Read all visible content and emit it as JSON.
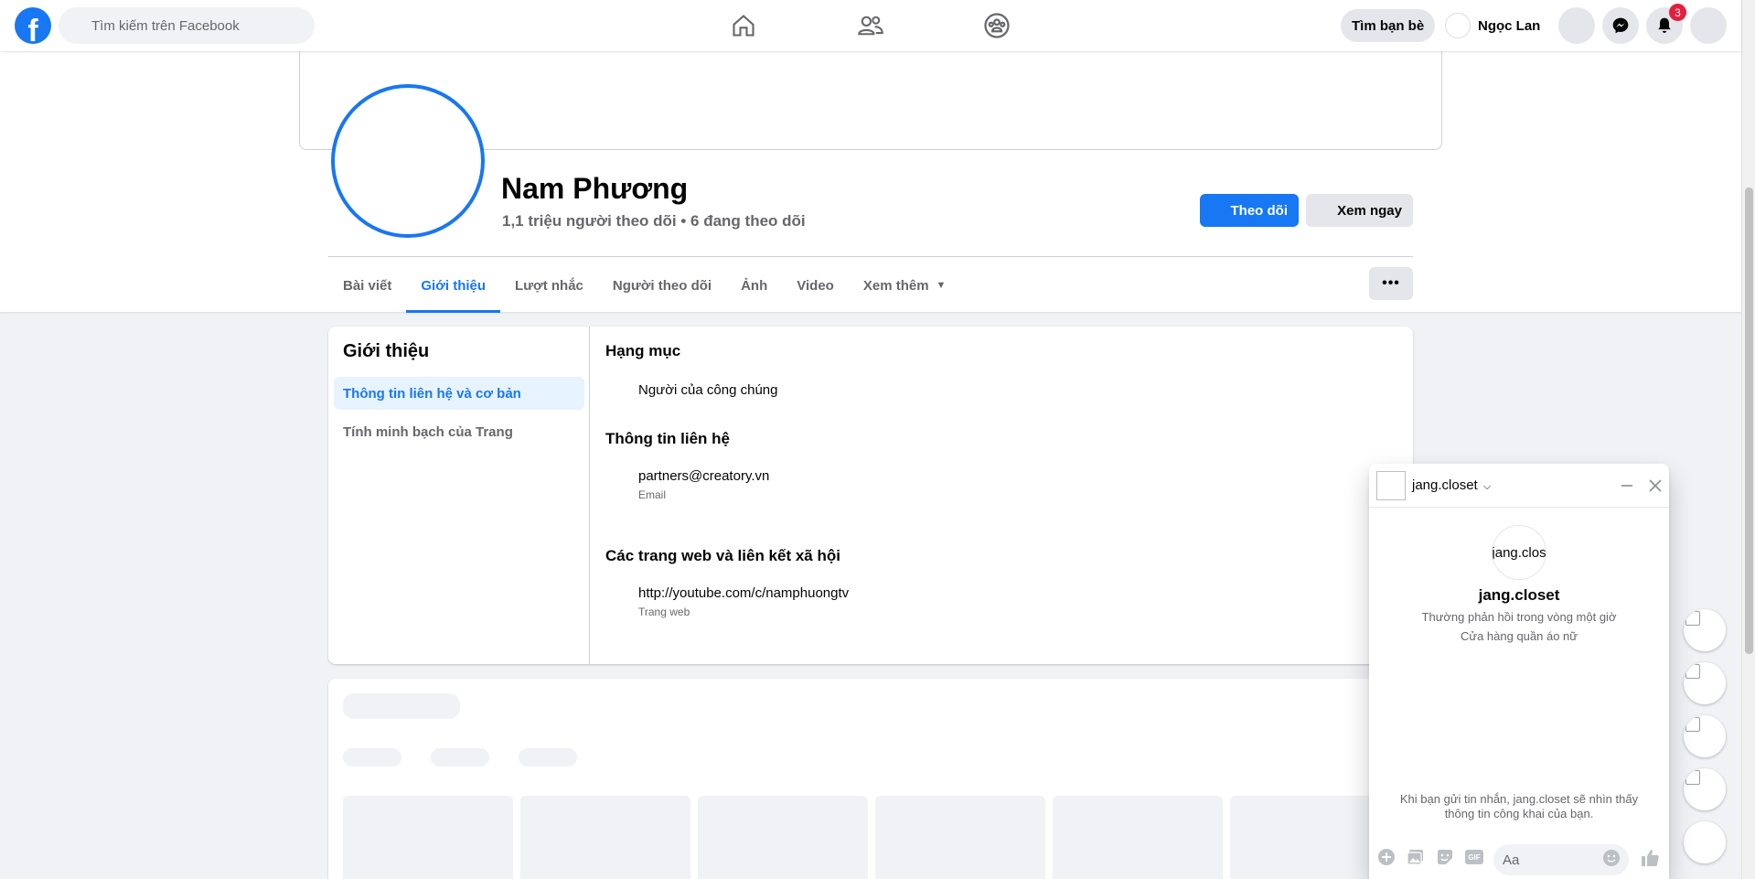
{
  "topbar": {
    "search_placeholder": "Tìm kiếm trên Facebook",
    "find_friends": "Tìm bạn bè",
    "user_name": "Ngọc Lan",
    "notification_count": "3",
    "logo_letter": "f"
  },
  "profile": {
    "name": "Nam Phương",
    "followers": "1,1 triệu người theo dõi • 6 đang theo dõi",
    "follow_label": "Theo dõi",
    "view_label": "Xem ngay",
    "more_label": "•••"
  },
  "tabs": [
    {
      "label": "Bài viết"
    },
    {
      "label": "Giới thiệu"
    },
    {
      "label": "Lượt nhắc"
    },
    {
      "label": "Người theo dõi"
    },
    {
      "label": "Ảnh"
    },
    {
      "label": "Video"
    },
    {
      "label": "Xem thêm"
    }
  ],
  "about": {
    "title": "Giới thiệu",
    "nav": [
      {
        "label": "Thông tin liên hệ và cơ bản"
      },
      {
        "label": "Tính minh bạch của Trang"
      }
    ],
    "category_title": "Hạng mục",
    "category_value": "Người của công chúng",
    "contact_title": "Thông tin liên hệ",
    "email_value": "partners@creatory.vn",
    "email_label": "Email",
    "web_title": "Các trang web và liên kết xã hội",
    "web_value": "http://youtube.com/c/namphuongtv",
    "web_label": "Trang web"
  },
  "chat": {
    "name": "jang.closet",
    "avatar_alt": "jang.clos",
    "title": "jang.closet",
    "reply_time": "Thường phản hồi trong vòng một giờ",
    "description": "Cửa hàng quần áo nữ",
    "note": "Khi bạn gửi tin nhắn, jang.closet sẽ nhìn thấy thông tin công khai của bạn.",
    "input_placeholder": "Aa",
    "gif_label": "GIF"
  },
  "colors": {
    "brand": "#1877f2",
    "badge": "#e41e3f"
  },
  "icons": [
    "facebook-logo",
    "search-icon",
    "home-icon",
    "friends-icon",
    "groups-icon",
    "messenger-icon",
    "bell-icon",
    "minimize-icon",
    "close-icon",
    "plus-icon",
    "photo-icon",
    "sticker-icon",
    "gif-icon",
    "emoji-icon",
    "like-icon"
  ]
}
